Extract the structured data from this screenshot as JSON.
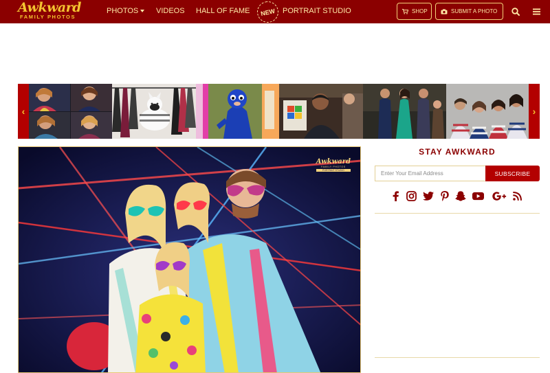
{
  "logo": {
    "main": "Awkward",
    "sub": "FAMILY PHOTOS"
  },
  "nav": {
    "items": [
      {
        "label": "PHOTOS",
        "has_dropdown": true
      },
      {
        "label": "VIDEOS"
      },
      {
        "label": "HALL OF FAME"
      },
      {
        "label": "PORTRAIT STUDIO"
      }
    ],
    "new_badge": "NEW",
    "shop_label": "SHOP",
    "submit_label": "SUBMIT A PHOTO",
    "icons": [
      "search-icon",
      "menu-icon"
    ],
    "bg_color": "#8b0000",
    "text_color": "#ffe9a6"
  },
  "strip": {
    "prev_arrow": "‹",
    "next_arrow": "›",
    "arrow_color": "#f4c430"
  },
  "main_photo": {
    "watermark": {
      "title": "Awkward",
      "sub": "FAMILY PHOTOS",
      "tag": "PORTRAIT STUDIO"
    }
  },
  "sidebar": {
    "title": "STAY AWKWARD",
    "email_placeholder": "Enter Your Email Address",
    "subscribe_label": "SUBSCRIBE",
    "social_icons": [
      "facebook-icon",
      "instagram-icon",
      "twitter-icon",
      "pinterest-icon",
      "snapchat-icon",
      "youtube-icon",
      "google-plus-icon",
      "rss-icon"
    ],
    "accent_color": "#8b0000",
    "button_color": "#b30000"
  }
}
